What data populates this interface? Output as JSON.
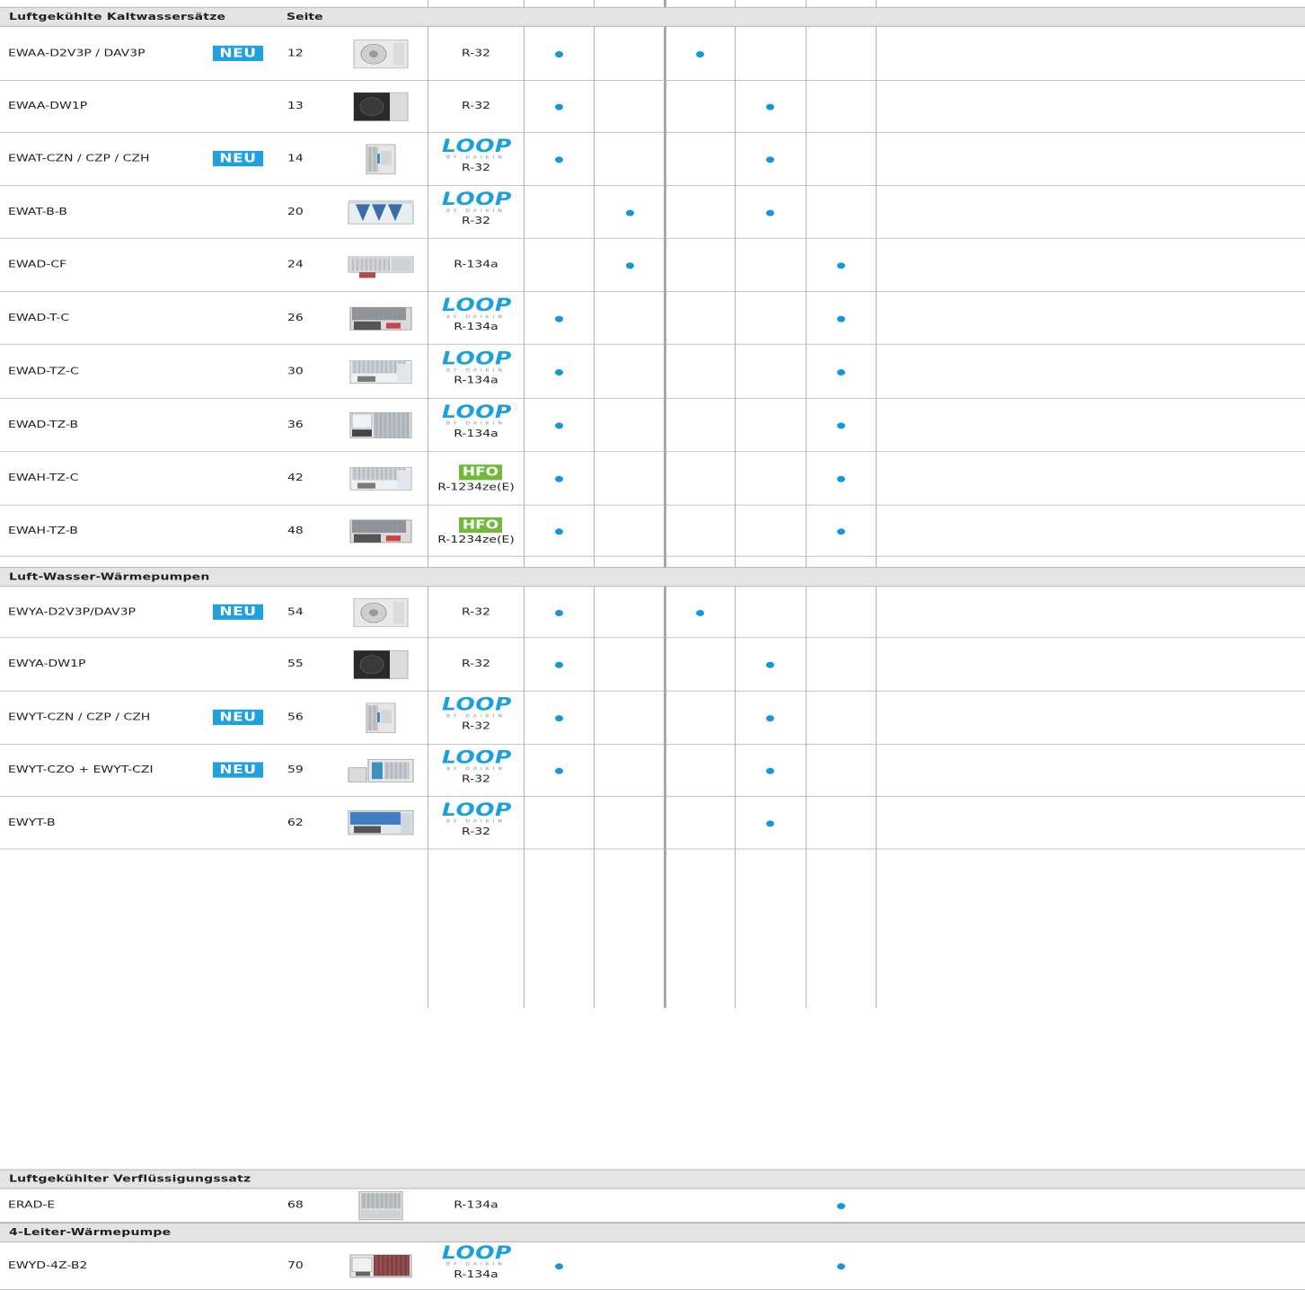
{
  "colors": {
    "dot": "#1597dc",
    "neu_badge": "#1fa0e0",
    "hfo_badge": "#6fba3a",
    "loop_logo": "#1aa0de",
    "section_bg": "#e4e4e4"
  },
  "header": {
    "seite_label": "Seite"
  },
  "badges": {
    "neu": "NEU",
    "hfo": "HFO",
    "loop": "LOOP",
    "loop_sub": "BY DAIKIN"
  },
  "sections": [
    {
      "title": "Luftgekühlte Kaltwassersätze",
      "show_seite": true,
      "rows": [
        {
          "name": "EWAA-D2V3P / DAV3P",
          "neu": true,
          "page": "12",
          "image": "compact-outdoor-unit-white",
          "loop": false,
          "hfo": false,
          "refrigerant": "R-32",
          "dots": [
            1,
            3
          ]
        },
        {
          "name": "EWAA-DW1P",
          "neu": false,
          "page": "13",
          "image": "compact-outdoor-unit-black",
          "loop": false,
          "hfo": false,
          "refrigerant": "R-32",
          "dots": [
            1,
            4
          ]
        },
        {
          "name": "EWAT-CZN / CZP / CZH",
          "neu": true,
          "page": "14",
          "image": "tall-cabinet-unit",
          "loop": true,
          "hfo": false,
          "refrigerant": "R-32",
          "dots": [
            1,
            4
          ]
        },
        {
          "name": "EWAT-B-B",
          "neu": false,
          "page": "20",
          "image": "v-coil-chiller",
          "loop": true,
          "hfo": false,
          "refrigerant": "R-32",
          "dots": [
            2,
            4
          ]
        },
        {
          "name": "EWAD-CF",
          "neu": false,
          "page": "24",
          "image": "flat-chiller",
          "loop": false,
          "hfo": false,
          "refrigerant": "R-134a",
          "dots": [
            2,
            5
          ]
        },
        {
          "name": "EWAD-T-C",
          "neu": false,
          "page": "26",
          "image": "screw-chiller-dark",
          "loop": true,
          "hfo": false,
          "refrigerant": "R-134a",
          "dots": [
            1,
            5
          ]
        },
        {
          "name": "EWAD-TZ-C",
          "neu": false,
          "page": "30",
          "image": "screw-chiller-light",
          "loop": true,
          "hfo": false,
          "refrigerant": "R-134a",
          "dots": [
            1,
            5
          ]
        },
        {
          "name": "EWAD-TZ-B",
          "neu": false,
          "page": "36",
          "image": "screw-chiller-panels",
          "loop": true,
          "hfo": false,
          "refrigerant": "R-134a",
          "dots": [
            1,
            5
          ]
        },
        {
          "name": "EWAH-TZ-C",
          "neu": false,
          "page": "42",
          "image": "screw-chiller-light",
          "loop": false,
          "hfo": true,
          "refrigerant": "R-1234ze(E)",
          "dots": [
            1,
            5
          ]
        },
        {
          "name": "EWAH-TZ-B",
          "neu": false,
          "page": "48",
          "image": "screw-chiller-dark",
          "loop": false,
          "hfo": true,
          "refrigerant": "R-1234ze(E)",
          "dots": [
            1,
            5
          ]
        }
      ]
    },
    {
      "title": "Luft-Wasser-Wärmepumpen",
      "show_seite": false,
      "rows": [
        {
          "name": "EWYA-D2V3P/DAV3P",
          "neu": true,
          "page": "54",
          "image": "compact-outdoor-unit-white",
          "loop": false,
          "hfo": false,
          "refrigerant": "R-32",
          "dots": [
            1,
            3
          ]
        },
        {
          "name": "EWYA-DW1P",
          "neu": false,
          "page": "55",
          "image": "compact-outdoor-unit-black",
          "loop": false,
          "hfo": false,
          "refrigerant": "R-32",
          "dots": [
            1,
            4
          ]
        },
        {
          "name": "EWYT-CZN / CZP / CZH",
          "neu": true,
          "page": "56",
          "image": "tall-cabinet-unit",
          "loop": true,
          "hfo": false,
          "refrigerant": "R-32",
          "dots": [
            1,
            4
          ]
        },
        {
          "name": "EWYT-CZO + EWYT-CZI",
          "neu": true,
          "page": "59",
          "image": "split-cabinet-unit",
          "loop": true,
          "hfo": false,
          "refrigerant": "R-32",
          "dots": [
            1,
            4
          ]
        },
        {
          "name": "EWYT-B",
          "neu": false,
          "page": "62",
          "image": "blue-coil-chiller",
          "loop": true,
          "hfo": false,
          "refrigerant": "R-32",
          "dots": [
            4
          ]
        }
      ]
    },
    {
      "title": "Luftgekühlter Verflüssigungssatz",
      "show_seite": false,
      "rows": [
        {
          "name": "ERAD-E",
          "neu": false,
          "page": "68",
          "image": "condensing-unit",
          "loop": false,
          "hfo": false,
          "refrigerant": "R-134a",
          "dots": [
            5
          ]
        }
      ]
    },
    {
      "title": "4-Leiter-Wärmepumpe",
      "show_seite": false,
      "rows": [
        {
          "name": "EWYD-4Z-B2",
          "neu": false,
          "page": "70",
          "image": "four-pipe-heat-pump",
          "loop": true,
          "hfo": false,
          "refrigerant": "R-134a",
          "dots": [
            1,
            5
          ]
        }
      ]
    }
  ]
}
